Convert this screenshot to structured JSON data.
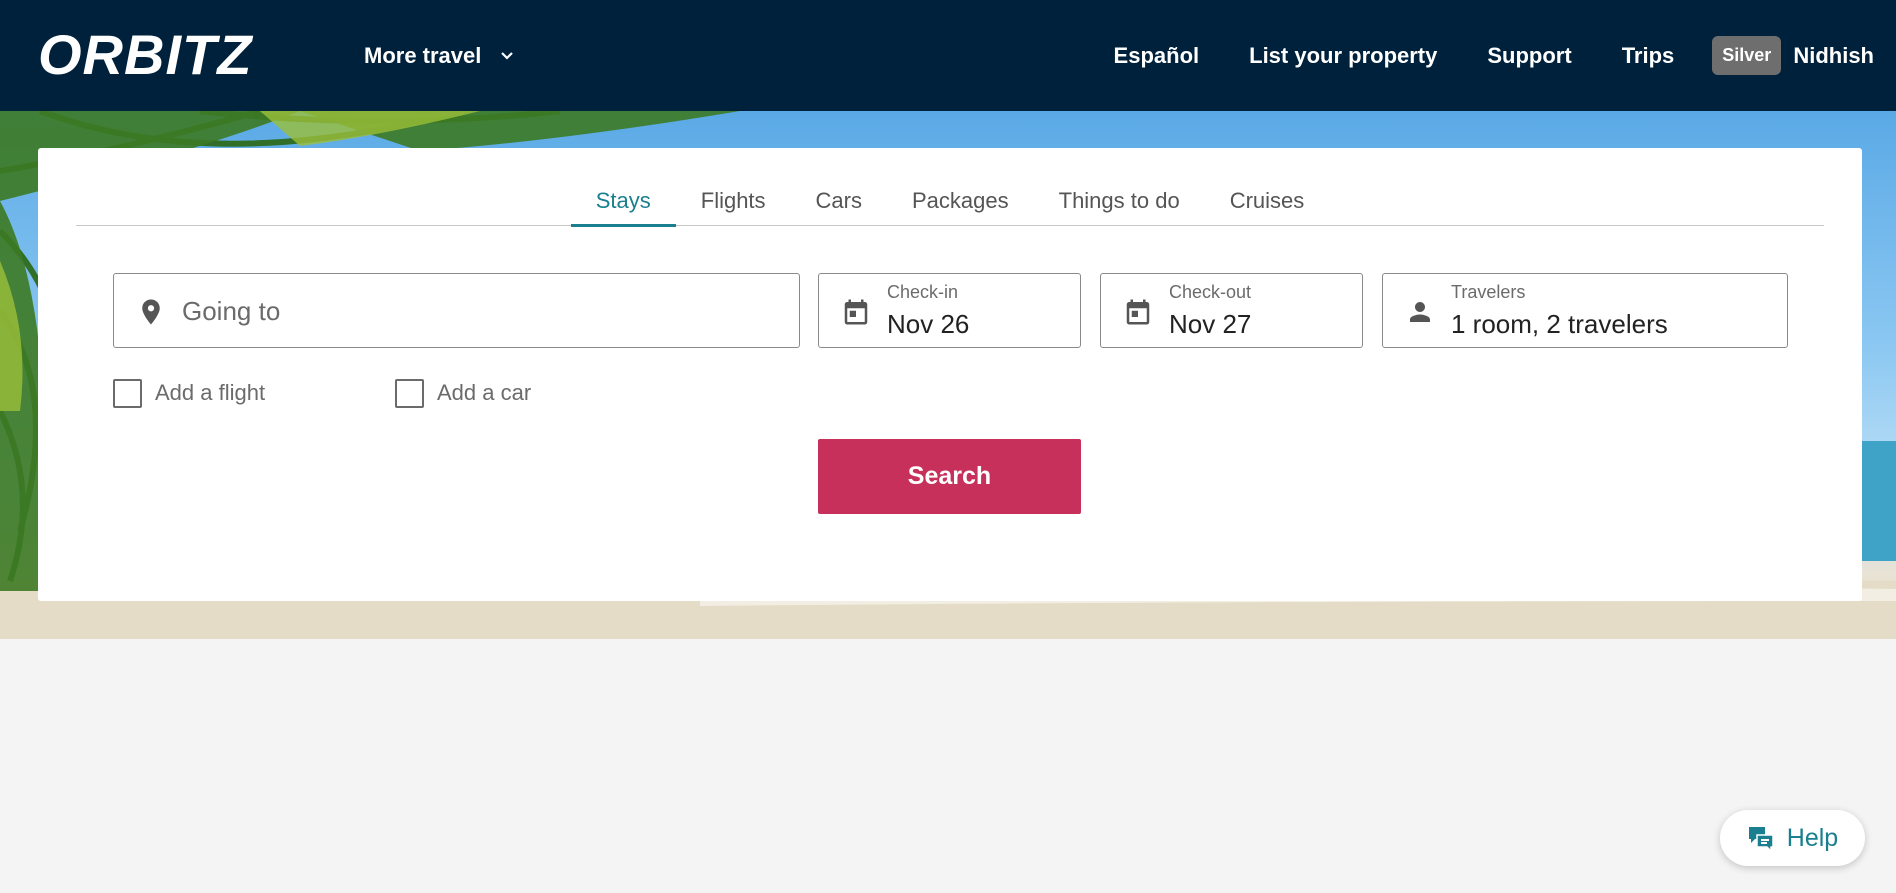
{
  "header": {
    "logo_text": "ORBITZ",
    "more_travel_label": "More travel",
    "nav": [
      "Español",
      "List your property",
      "Support",
      "Trips"
    ],
    "badge": "Silver",
    "user_name": "Nidhish"
  },
  "search": {
    "tabs": [
      {
        "label": "Stays",
        "active": true
      },
      {
        "label": "Flights",
        "active": false
      },
      {
        "label": "Cars",
        "active": false
      },
      {
        "label": "Packages",
        "active": false
      },
      {
        "label": "Things to do",
        "active": false
      },
      {
        "label": "Cruises",
        "active": false
      }
    ],
    "destination_placeholder": "Going to",
    "checkin": {
      "label": "Check-in",
      "value": "Nov 26"
    },
    "checkout": {
      "label": "Check-out",
      "value": "Nov 27"
    },
    "travelers": {
      "label": "Travelers",
      "value": "1 room, 2 travelers"
    },
    "add_flight": "Add a flight",
    "add_car": "Add a car",
    "search_button": "Search"
  },
  "help": {
    "label": "Help"
  },
  "colors": {
    "header_bg": "#00213b",
    "accent": "#1a7f8f",
    "search_button": "#c7305a",
    "badge_bg": "#6e6e6e"
  },
  "icons": {
    "logo": "orbitz-logo",
    "chevron": "chevron-down-icon",
    "location": "location-pin-icon",
    "calendar": "calendar-icon",
    "person": "person-icon",
    "help": "chat-bubble-icon"
  }
}
